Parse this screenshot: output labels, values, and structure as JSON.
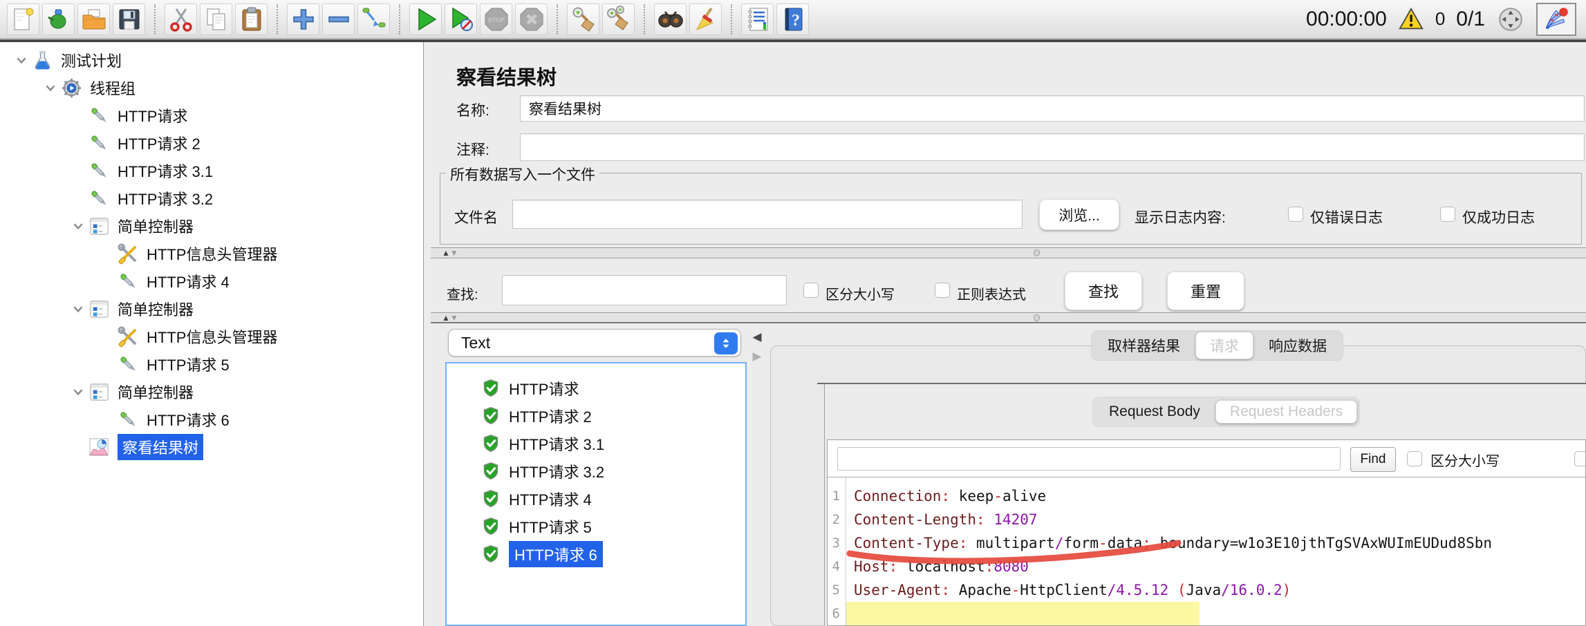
{
  "toolbar": {
    "items": [
      {
        "name": "new-file",
        "icon": "new"
      },
      {
        "name": "templates",
        "icon": "templates"
      },
      {
        "name": "open-file",
        "icon": "open"
      },
      {
        "name": "save",
        "icon": "save"
      },
      {
        "sep": true
      },
      {
        "name": "cut",
        "icon": "cut"
      },
      {
        "name": "copy",
        "icon": "copy"
      },
      {
        "name": "paste",
        "icon": "paste"
      },
      {
        "sep": true
      },
      {
        "name": "expand-add",
        "icon": "add"
      },
      {
        "name": "collapse-remove",
        "icon": "remove"
      },
      {
        "name": "toggle",
        "icon": "toggle"
      },
      {
        "sep": true
      },
      {
        "name": "start",
        "icon": "start"
      },
      {
        "name": "start-no-timers",
        "icon": "start-nt"
      },
      {
        "name": "stop",
        "icon": "stop",
        "disabled": true
      },
      {
        "name": "shutdown",
        "icon": "shutdown",
        "disabled": true
      },
      {
        "sep": true
      },
      {
        "name": "clear",
        "icon": "clear"
      },
      {
        "name": "clear-all",
        "icon": "clear-all"
      },
      {
        "sep": true
      },
      {
        "name": "search",
        "icon": "search"
      },
      {
        "name": "search-reset",
        "icon": "search-reset"
      },
      {
        "sep": true
      },
      {
        "name": "function-helper",
        "icon": "function"
      },
      {
        "name": "help",
        "icon": "help"
      }
    ],
    "timer": "00:00:00",
    "warning_count": "0",
    "thread_count": "0/1"
  },
  "tree": {
    "items": [
      {
        "label": "测试计划",
        "level": 0,
        "icon": "testplan",
        "chevron": true
      },
      {
        "label": "线程组",
        "level": 1,
        "icon": "threadgroup",
        "chevron": true
      },
      {
        "label": "HTTP请求",
        "level": 2,
        "icon": "http"
      },
      {
        "label": "HTTP请求 2",
        "level": 2,
        "icon": "http"
      },
      {
        "label": "HTTP请求 3.1",
        "level": 2,
        "icon": "http"
      },
      {
        "label": "HTTP请求 3.2",
        "level": 2,
        "icon": "http"
      },
      {
        "label": "简单控制器",
        "level": 2,
        "icon": "controller",
        "chevron": true
      },
      {
        "label": "HTTP信息头管理器",
        "level": 3,
        "icon": "headers"
      },
      {
        "label": "HTTP请求 4",
        "level": 3,
        "icon": "http"
      },
      {
        "label": "简单控制器",
        "level": 2,
        "icon": "controller",
        "chevron": true
      },
      {
        "label": "HTTP信息头管理器",
        "level": 3,
        "icon": "headers"
      },
      {
        "label": "HTTP请求 5",
        "level": 3,
        "icon": "http"
      },
      {
        "label": "简单控制器",
        "level": 2,
        "icon": "controller",
        "chevron": true
      },
      {
        "label": "HTTP请求 6",
        "level": 3,
        "icon": "http"
      },
      {
        "label": "察看结果树",
        "level": 2,
        "icon": "resulttree",
        "selected": true
      }
    ]
  },
  "main": {
    "title": "察看结果树",
    "name_label": "名称:",
    "name_value": "察看结果树",
    "comment_label": "注释:",
    "comment_value": "",
    "file_group": {
      "legend": "所有数据写入一个文件",
      "filename_label": "文件名",
      "filename_value": "",
      "browse": "浏览...",
      "log_label": "显示日志内容:",
      "errors_label": "仅错误日志",
      "success_label": "仅成功日志"
    },
    "search_bar": {
      "label": "查找:",
      "value": "",
      "case_label": "区分大小写",
      "regex_label": "正则表达式",
      "find": "查找",
      "reset": "重置"
    },
    "results": {
      "mode": "Text",
      "items": [
        {
          "label": "HTTP请求"
        },
        {
          "label": "HTTP请求 2"
        },
        {
          "label": "HTTP请求 3.1"
        },
        {
          "label": "HTTP请求 3.2"
        },
        {
          "label": "HTTP请求 4"
        },
        {
          "label": "HTTP请求 5"
        },
        {
          "label": "HTTP请求 6",
          "selected": true
        }
      ]
    },
    "tabs": {
      "items": [
        {
          "label": "取样器结果"
        },
        {
          "label": "请求",
          "selected": true
        },
        {
          "label": "响应数据"
        }
      ]
    },
    "request_tabs": {
      "items": [
        {
          "label": "Request Body"
        },
        {
          "label": "Request Headers",
          "selected": true
        }
      ]
    },
    "finder": {
      "value": "",
      "find": "Find",
      "case_label": "区分大小写"
    },
    "code": {
      "lines": [
        {
          "num": "1",
          "segs": [
            [
              "Connection",
              "k"
            ],
            [
              ":",
              "p"
            ],
            [
              " keep",
              "v"
            ],
            [
              "-",
              "p"
            ],
            [
              "alive",
              "v"
            ]
          ]
        },
        {
          "num": "2",
          "segs": [
            [
              "Content-Length",
              "k"
            ],
            [
              ":",
              "p"
            ],
            [
              " ",
              "v"
            ],
            [
              "14207",
              "n"
            ]
          ]
        },
        {
          "num": "3",
          "segs": [
            [
              "Content-Type",
              "k"
            ],
            [
              ":",
              "p"
            ],
            [
              " multipart",
              "v"
            ],
            [
              "/",
              "n"
            ],
            [
              "form",
              "v"
            ],
            [
              "-",
              "p"
            ],
            [
              "data",
              "v"
            ],
            [
              ";",
              "p"
            ],
            [
              " boundary=w1o3E10jthTgSVAxWUImEUDud8Sbn",
              "v"
            ]
          ]
        },
        {
          "num": "4",
          "segs": [
            [
              "Host",
              "k"
            ],
            [
              ":",
              "p"
            ],
            [
              " localhost",
              "v"
            ],
            [
              ":",
              "p"
            ],
            [
              "8080",
              "n"
            ]
          ]
        },
        {
          "num": "5",
          "segs": [
            [
              "User-Agent",
              "k"
            ],
            [
              ":",
              "p"
            ],
            [
              " Apache",
              "v"
            ],
            [
              "-",
              "p"
            ],
            [
              "HttpClient",
              "v"
            ],
            [
              "/",
              "n"
            ],
            [
              "4.5.12",
              "n"
            ],
            [
              " ",
              "v"
            ],
            [
              "(",
              "p"
            ],
            [
              "Java",
              "v"
            ],
            [
              "/",
              "n"
            ],
            [
              "16.0.2",
              "n"
            ],
            [
              ")",
              "p"
            ]
          ]
        },
        {
          "num": "6",
          "segs": [],
          "current": true
        }
      ]
    }
  },
  "colors": {
    "selection_blue": "#2262e8",
    "current_line_yellow": "#fbf7a3",
    "annotation_red": "#e5493d",
    "results_focus_border": "#6fb1fc",
    "key_maroon": "#6e1d1d",
    "number_purple": "#8b17a8"
  }
}
